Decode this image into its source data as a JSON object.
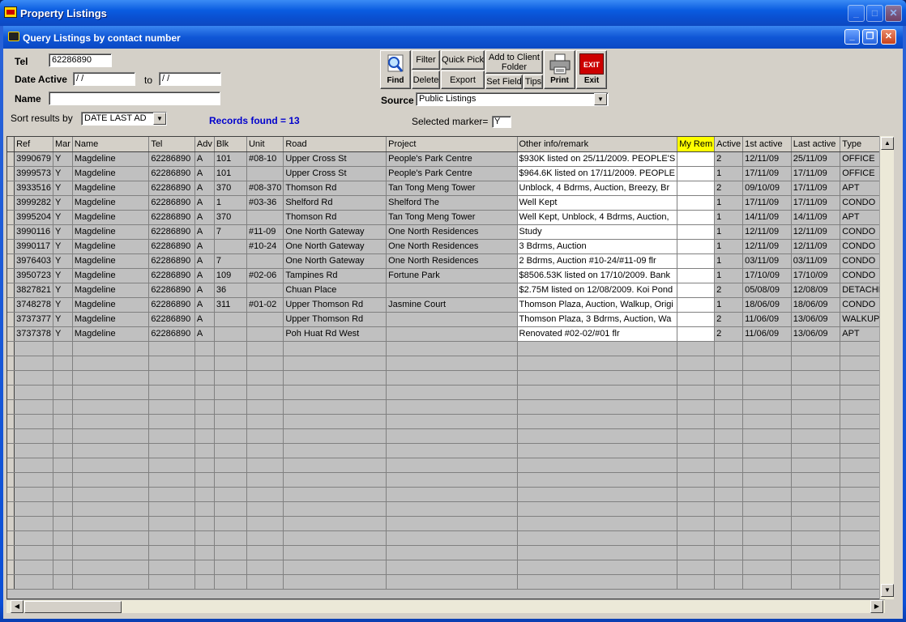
{
  "window": {
    "title": "Property Listings"
  },
  "subwindow": {
    "title": "Query Listings by contact number"
  },
  "form": {
    "tel_label": "Tel",
    "tel_value": "62286890",
    "date_active_label": "Date Active",
    "date_from": " / /",
    "date_to_label": "to",
    "date_to": " / /",
    "name_label": "Name",
    "name_value": "",
    "sort_label": "Sort results by",
    "sort_value": "DATE LAST AD",
    "records_found": "Records found =  13",
    "source_label": "Source",
    "source_value": "Public Listings",
    "selected_marker_label": "Selected marker=",
    "selected_marker_value": "Y"
  },
  "toolbar": {
    "find": "Find",
    "filter": "Filter",
    "delete": "Delete",
    "quick_pick": "Quick Pick",
    "export": "Export",
    "add_to_client_folder_1": "Add to Client",
    "add_to_client_folder_2": "Folder",
    "set_field": "Set Field",
    "tips": "Tips",
    "print": "Print",
    "exit": "Exit",
    "exit_icon_text": "EXIT"
  },
  "table": {
    "columns": [
      "Ref",
      "Mar",
      "Name",
      "Tel",
      "Adv",
      "Blk",
      "Unit",
      "Road",
      "Project",
      "Other info/remark",
      "My Rem",
      "Active",
      "1st active",
      "Last active",
      "Type"
    ],
    "rows": [
      [
        "3990679",
        "Y",
        "Magdeline",
        "62286890",
        "A",
        "101",
        "#08-10",
        "Upper Cross St",
        "People's Park Centre",
        "$930K listed on 25/11/2009. PEOPLE'S",
        "",
        "2",
        "12/11/09",
        "25/11/09",
        "OFFICE"
      ],
      [
        "3999573",
        "Y",
        "Magdeline",
        "62286890",
        "A",
        "101",
        "",
        "Upper Cross St",
        "People's Park Centre",
        "$964.6K listed on 17/11/2009. PEOPLE",
        "",
        "1",
        "17/11/09",
        "17/11/09",
        "OFFICE"
      ],
      [
        "3933516",
        "Y",
        "Magdeline",
        "62286890",
        "A",
        "370",
        "#08-370",
        "Thomson Rd",
        "Tan Tong Meng Tower",
        "Unblock, 4 Bdrms, Auction, Breezy, Br",
        "",
        "2",
        "09/10/09",
        "17/11/09",
        "APT"
      ],
      [
        "3999282",
        "Y",
        "Magdeline",
        "62286890",
        "A",
        "1",
        "#03-36",
        "Shelford Rd",
        "Shelford The",
        "Well Kept",
        "",
        "1",
        "17/11/09",
        "17/11/09",
        "CONDO"
      ],
      [
        "3995204",
        "Y",
        "Magdeline",
        "62286890",
        "A",
        "370",
        "",
        "Thomson Rd",
        "Tan Tong Meng Tower",
        "Well Kept, Unblock, 4 Bdrms, Auction,",
        "",
        "1",
        "14/11/09",
        "14/11/09",
        "APT"
      ],
      [
        "3990116",
        "Y",
        "Magdeline",
        "62286890",
        "A",
        "7",
        "#11-09",
        "One North Gateway",
        "One North Residences",
        "Study",
        "",
        "1",
        "12/11/09",
        "12/11/09",
        "CONDO"
      ],
      [
        "3990117",
        "Y",
        "Magdeline",
        "62286890",
        "A",
        "",
        "#10-24",
        "One North Gateway",
        "One North Residences",
        "3 Bdrms, Auction",
        "",
        "1",
        "12/11/09",
        "12/11/09",
        "CONDO"
      ],
      [
        "3976403",
        "Y",
        "Magdeline",
        "62286890",
        "A",
        "7",
        "",
        "One North Gateway",
        "One North Residences",
        "2 Bdrms, Auction #10-24/#11-09 flr",
        "",
        "1",
        "03/11/09",
        "03/11/09",
        "CONDO"
      ],
      [
        "3950723",
        "Y",
        "Magdeline",
        "62286890",
        "A",
        "109",
        "#02-06",
        "Tampines Rd",
        "Fortune Park",
        "$8506.53K listed on 17/10/2009. Bank",
        "",
        "1",
        "17/10/09",
        "17/10/09",
        "CONDO"
      ],
      [
        "3827821",
        "Y",
        "Magdeline",
        "62286890",
        "A",
        "36",
        "",
        "Chuan Place",
        "",
        "$2.75M listed on 12/08/2009. Koi Pond",
        "",
        "2",
        "05/08/09",
        "12/08/09",
        "DETACHED"
      ],
      [
        "3748278",
        "Y",
        "Magdeline",
        "62286890",
        "A",
        "311",
        "#01-02",
        "Upper Thomson Rd",
        "Jasmine Court",
        "Thomson Plaza, Auction, Walkup, Origi",
        "",
        "1",
        "18/06/09",
        "18/06/09",
        "CONDO"
      ],
      [
        "3737377",
        "Y",
        "Magdeline",
        "62286890",
        "A",
        "",
        "",
        "Upper Thomson Rd",
        "",
        "Thomson Plaza, 3 Bdrms, Auction, Wa",
        "",
        "2",
        "11/06/09",
        "13/06/09",
        "WALKUP"
      ],
      [
        "3737378",
        "Y",
        "Magdeline",
        "62286890",
        "A",
        "",
        "",
        "Poh Huat Rd West",
        "",
        "Renovated #02-02/#01 flr",
        "",
        "2",
        "11/06/09",
        "13/06/09",
        "APT"
      ]
    ]
  },
  "icons": {
    "title_buttons": [
      "minimize-icon",
      "maximize-icon",
      "close-icon"
    ],
    "scroll": [
      "arrow-up-icon",
      "arrow-down-icon",
      "arrow-left-icon",
      "arrow-right-icon"
    ]
  }
}
